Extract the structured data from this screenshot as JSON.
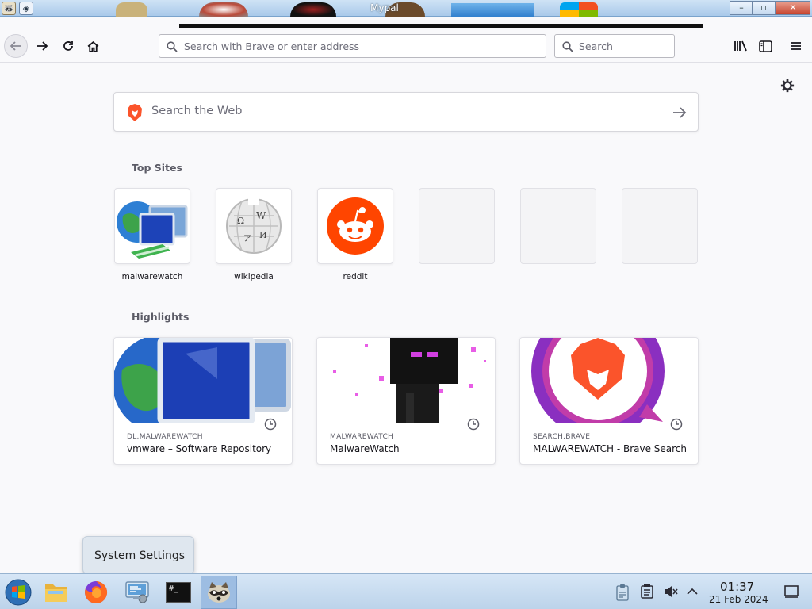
{
  "window": {
    "title": "Mypal",
    "minimize_glyph": "–",
    "maximize_glyph": "▫",
    "close_glyph": "✕"
  },
  "toolbar": {
    "url_placeholder": "Search with Brave or enter address",
    "search_placeholder": "Search"
  },
  "newtab": {
    "search_placeholder": "Search the Web",
    "top_sites_title": "Top Sites",
    "highlights_title": "Highlights",
    "top_sites": [
      {
        "label": "malwarewatch",
        "icon": "network-computers-icon"
      },
      {
        "label": "wikipedia",
        "icon": "wikipedia-globe-icon"
      },
      {
        "label": "reddit",
        "icon": "reddit-icon"
      },
      {
        "label": "",
        "icon": ""
      },
      {
        "label": "",
        "icon": ""
      },
      {
        "label": "",
        "icon": ""
      }
    ],
    "highlights": [
      {
        "host": "DL.MALWAREWATCH",
        "title": "vmware – Software Repository"
      },
      {
        "host": "MALWAREWATCH",
        "title": "MalwareWatch"
      },
      {
        "host": "SEARCH.BRAVE",
        "title": "MALWAREWATCH - Brave Search"
      }
    ]
  },
  "tooltip": {
    "text": "System Settings"
  },
  "taskbar": {
    "time": "01:37",
    "date": "21 Feb 2024",
    "terminal_label": "#_",
    "colors": {
      "brave": "#fb542b",
      "reddit": "#ff4500",
      "accent": "#9dbde2"
    }
  }
}
